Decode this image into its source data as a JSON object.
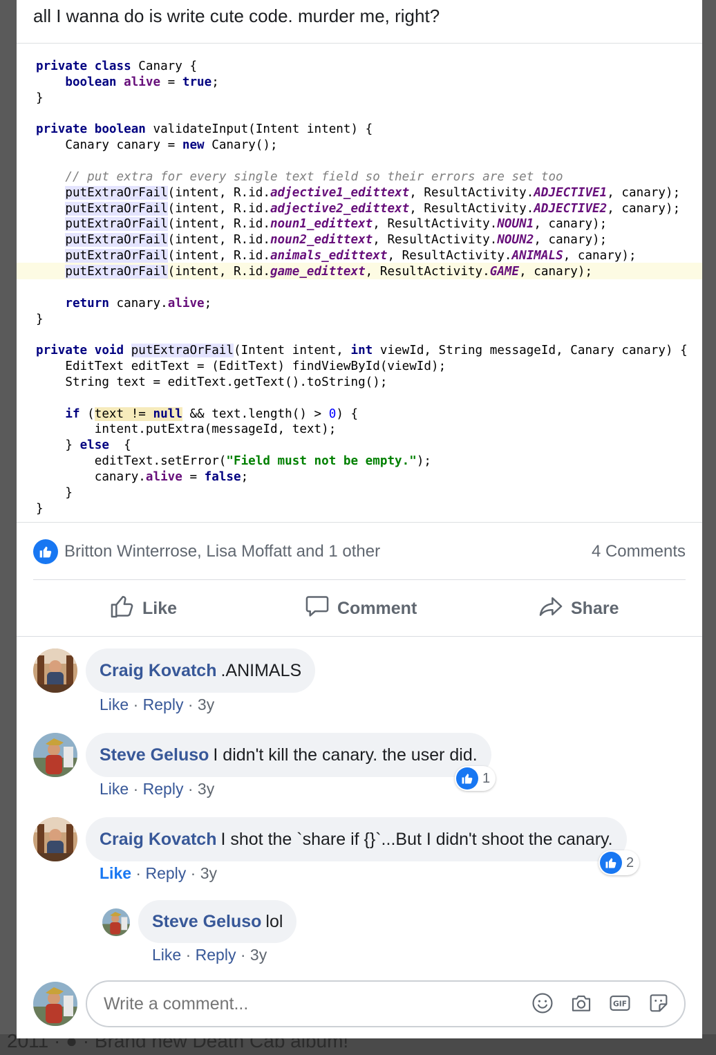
{
  "post": {
    "text": "all I wanna do is write cute code. murder me, right?"
  },
  "reactions": {
    "names": "Britton Winterrose, Lisa Moffatt and 1 other",
    "comment_count": "4 Comments"
  },
  "actions": {
    "like": "Like",
    "comment": "Comment",
    "share": "Share"
  },
  "comments": [
    {
      "author": "Craig Kovatch",
      "text": ".ANIMALS",
      "like": "Like",
      "reply": "Reply",
      "age": "3y"
    },
    {
      "author": "Steve Geluso",
      "text": "I didn't kill the canary. the user did.",
      "like": "Like",
      "reply": "Reply",
      "age": "3y",
      "reaction_count": "1"
    },
    {
      "author": "Craig Kovatch",
      "text": "I shot the `share if {}`...But I didn't shoot the canary.",
      "like": "Like",
      "reply": "Reply",
      "age": "3y",
      "reaction_count": "2",
      "replies": [
        {
          "author": "Steve Geluso",
          "text": "lol",
          "like": "Like",
          "reply": "Reply",
          "age": "3y"
        }
      ]
    }
  ],
  "composer": {
    "placeholder": "Write a comment..."
  },
  "background": {
    "bottom_text": "2011 · ● · Brand new Death Cab album!"
  },
  "colors": {
    "brand_blue": "#1877f2",
    "author_blue": "#385898",
    "bubble_gray": "#f0f2f5"
  },
  "icons": [
    "like-badge-icon",
    "thumbs-up-icon",
    "comment-icon",
    "share-icon",
    "emoji-icon",
    "camera-icon",
    "gif-icon",
    "sticker-icon"
  ]
}
